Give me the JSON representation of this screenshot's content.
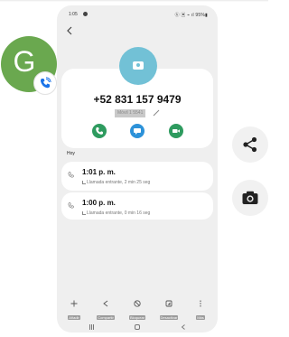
{
  "status_bar": {
    "time": "1:05",
    "right_indicators": "ⓑ ▣ ⌁ ıl 95%▮"
  },
  "contact": {
    "phone_number": "+52 831 157 9479",
    "sim_label": "Móvil 1 5541"
  },
  "actions": {
    "call_icon": "phone-icon",
    "message_icon": "message-icon",
    "video_icon": "video-icon"
  },
  "call_log": {
    "section_title": "Hoy",
    "entries": [
      {
        "time": "1:01 p. m.",
        "detail": "Llamada entrante, 2 min 25 seg"
      },
      {
        "time": "1:00 p. m.",
        "detail": "Llamada entrante, 0 min 16 seg"
      }
    ]
  },
  "bottom_bar": {
    "items": [
      {
        "label": "Añadir",
        "icon": "plus-icon"
      },
      {
        "label": "Compartir",
        "icon": "share-icon"
      },
      {
        "label": "Bloquear",
        "icon": "block-icon"
      },
      {
        "label": "Desactivar",
        "icon": "mute-icon"
      },
      {
        "label": "Más",
        "icon": "more-icon"
      }
    ]
  },
  "overlay": {
    "avatar_letter": "G",
    "avatar_color": "#6aa84f",
    "badge_icon": "phone-call-icon"
  },
  "side_actions": {
    "share_icon": "share-icon",
    "camera_icon": "camera-icon"
  },
  "colors": {
    "call_green": "#2e9b5f",
    "message_blue": "#2d92d9",
    "contact_avatar": "#72c1d6"
  }
}
